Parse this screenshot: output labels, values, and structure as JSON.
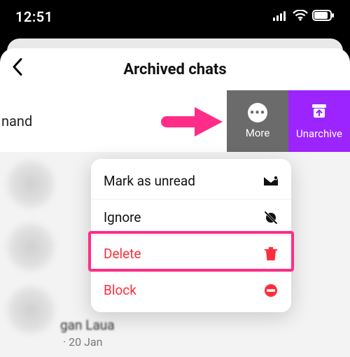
{
  "statusbar": {
    "time": "12:51"
  },
  "header": {
    "title": "Archived chats"
  },
  "row": {
    "name_fragment": "nand"
  },
  "actions": {
    "more_label": "More",
    "unarchive_label": "Unarchive"
  },
  "menu": {
    "mark_unread": "Mark as unread",
    "ignore": "Ignore",
    "delete": "Delete",
    "block": "Block"
  },
  "list_bottom": {
    "name_blurred": "gan Laua",
    "subtitle": "· 20 Jan"
  }
}
